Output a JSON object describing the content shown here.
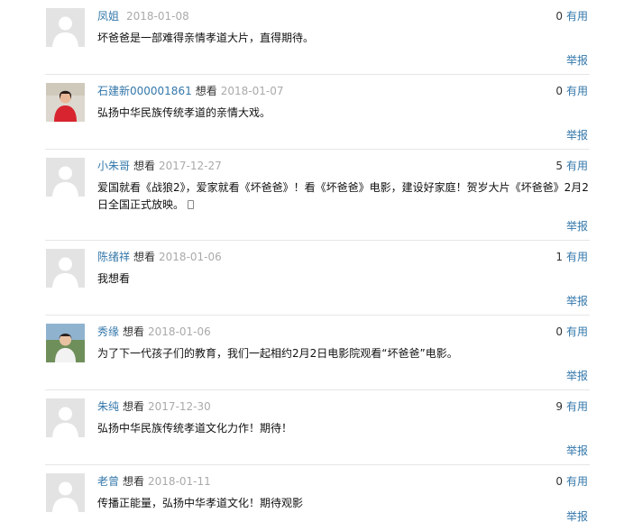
{
  "comments": [
    {
      "user": "凤姐",
      "status": "",
      "date": "2018-01-08",
      "votes": "0",
      "vote_label": "有用",
      "text": "坏爸爸是一部难得亲情孝道大片，直得期待。",
      "report_label": "举报",
      "avatar": "default-avatar"
    },
    {
      "user": "石建新000001861",
      "status": "想看",
      "date": "2018-01-07",
      "votes": "0",
      "vote_label": "有用",
      "text": "弘扬中华民族传统孝道的亲情大戏。",
      "report_label": "举报",
      "avatar": "photo-avatar-red"
    },
    {
      "user": "小朱哥",
      "status": "想看",
      "date": "2017-12-27",
      "votes": "5",
      "vote_label": "有用",
      "text": "爱国就看《战狼2》，爱家就看《坏爸爸》！看《坏爸爸》电影，建设好家庭！贺岁大片《坏爸爸》2月2日全国正式放映。",
      "report_label": "举报",
      "avatar": "default-avatar"
    },
    {
      "user": "陈绪祥",
      "status": "想看",
      "date": "2018-01-06",
      "votes": "1",
      "vote_label": "有用",
      "text": "我想看",
      "report_label": "举报",
      "avatar": "default-avatar"
    },
    {
      "user": "秀缘",
      "status": "想看",
      "date": "2018-01-06",
      "votes": "0",
      "vote_label": "有用",
      "text": "为了下一代孩子们的教育，我们一起相约2月2日电影院观看“坏爸爸”电影。",
      "report_label": "举报",
      "avatar": "photo-avatar-outdoor"
    },
    {
      "user": "朱纯",
      "status": "想看",
      "date": "2017-12-30",
      "votes": "9",
      "vote_label": "有用",
      "text": "弘扬中华民族传统孝道文化力作！期待！",
      "report_label": "举报",
      "avatar": "default-avatar"
    },
    {
      "user": "老曾",
      "status": "想看",
      "date": "2018-01-11",
      "votes": "0",
      "vote_label": "有用",
      "text": "传播正能量，弘扬中华孝道文化！期待观影",
      "report_label": "举报",
      "avatar": "default-avatar"
    }
  ],
  "colors": {
    "link": "#3377aa",
    "date": "#aaaaaa",
    "text": "#111111",
    "divider": "#e6e6e6"
  }
}
